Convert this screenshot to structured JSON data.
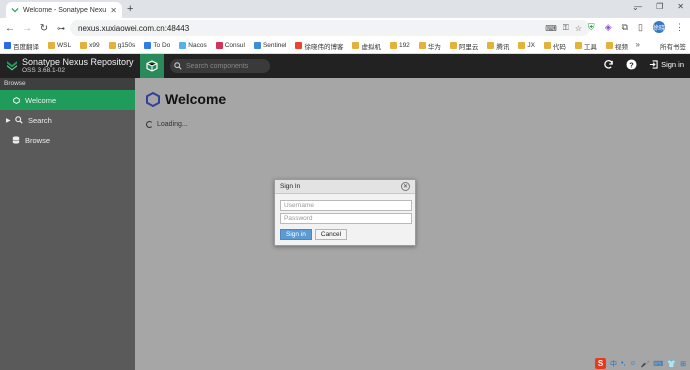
{
  "browser": {
    "tab": {
      "title": "Welcome - Sonatype Nexus Repository",
      "favicon": "nexus-favicon"
    },
    "url": "nexus.xuxiaowei.com.cn:48443",
    "avatar_text": "徐晓",
    "bookmarks": [
      {
        "label": "百度翻译",
        "color": "#2b6ae0"
      },
      {
        "label": "WSL",
        "color": "#e6b03c"
      },
      {
        "label": "x99",
        "color": "#e6b03c"
      },
      {
        "label": "g150s",
        "color": "#e6b03c"
      },
      {
        "label": "To Do",
        "color": "#2f7ee8"
      },
      {
        "label": "Nacos",
        "color": "#5ab0e8"
      },
      {
        "label": "Consul",
        "color": "#d6335b"
      },
      {
        "label": "Sentinel",
        "color": "#3a8fd6"
      },
      {
        "label": "徐晓伟的博客",
        "color": "#e8452c"
      },
      {
        "label": "虚拟机",
        "color": "#e6b03c"
      },
      {
        "label": "192",
        "color": "#e6b03c"
      },
      {
        "label": "华为",
        "color": "#e6b03c"
      },
      {
        "label": "阿里云",
        "color": "#e6b03c"
      },
      {
        "label": "腾讯",
        "color": "#e6b03c"
      },
      {
        "label": "JX",
        "color": "#e6b03c"
      },
      {
        "label": "代码",
        "color": "#e6b03c"
      },
      {
        "label": "工具",
        "color": "#e6b03c"
      },
      {
        "label": "视频",
        "color": "#e6b03c"
      }
    ],
    "all_bookmarks": "所有书签"
  },
  "nexus": {
    "title": "Sonatype Nexus Repository",
    "version": "OSS 3.68.1-02",
    "search_placeholder": "Search components",
    "sign_in_label": "Sign in",
    "accent": "#1f9b5a"
  },
  "sidebar": {
    "header": "Browse",
    "items": [
      {
        "label": "Welcome",
        "icon": "hexagon-icon",
        "active": true
      },
      {
        "label": "Search",
        "icon": "search-icon",
        "active": false
      },
      {
        "label": "Browse",
        "icon": "database-icon",
        "active": false
      }
    ]
  },
  "main": {
    "heading": "Welcome",
    "loading_text": "Loading..."
  },
  "dialog": {
    "title": "Sign In",
    "username_placeholder": "Username",
    "password_placeholder": "Password",
    "submit_label": "Sign in",
    "cancel_label": "Cancel"
  }
}
